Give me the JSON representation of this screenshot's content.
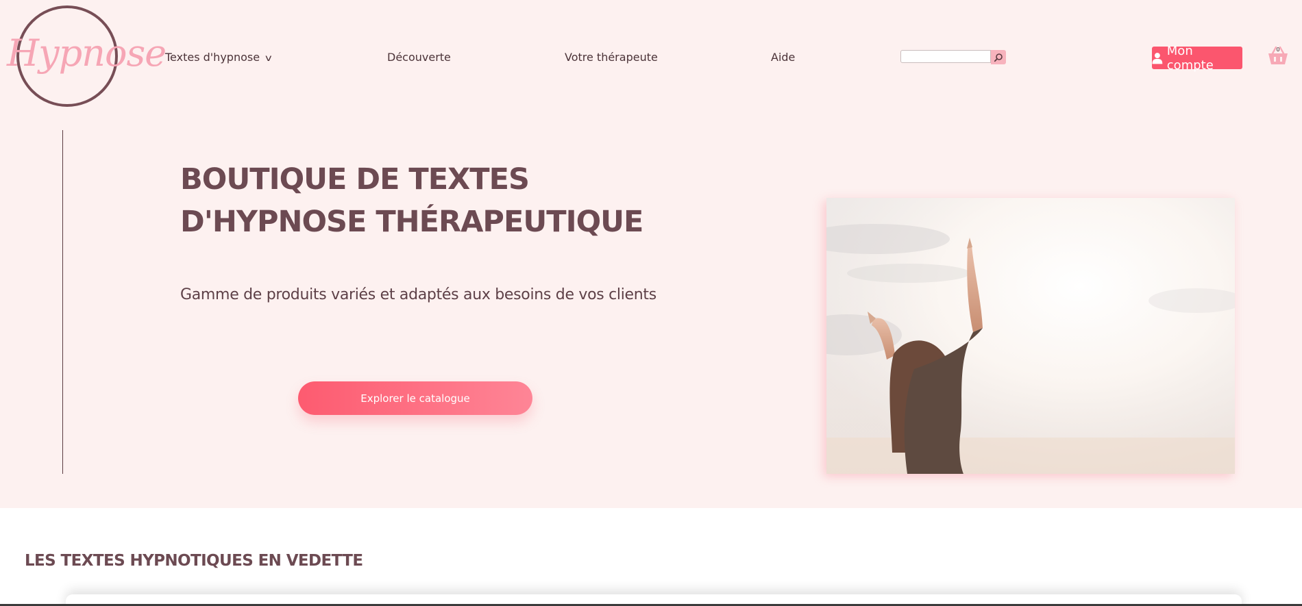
{
  "header": {
    "logo_text": "Hypnose",
    "nav": [
      {
        "label": "Textes d'hypnose",
        "has_dropdown": true
      },
      {
        "label": "Découverte"
      },
      {
        "label": "Votre thérapeute"
      },
      {
        "label": "Aide"
      }
    ],
    "search": {
      "value": "",
      "placeholder": ""
    },
    "account_label": "Mon compte",
    "cart_count": "0"
  },
  "hero": {
    "title": "BOUTIQUE DE TEXTES D'HYPNOSE THÉRAPEUTIQUE",
    "subtitle": "Gamme de produits variés et adaptés aux besoins de vos clients",
    "cta_label": "Explorer le catalogue",
    "image_icon": "woman-raising-arms-sky-photo"
  },
  "featured": {
    "title": "LES TEXTES HYPNOTIQUES EN VEDETTE"
  },
  "colors": {
    "hero_background": "#fdf1f0",
    "accent": "#fb566e",
    "title": "#6c4a52",
    "logo_pink": "#f6a6b5",
    "logo_circle": "#774e56"
  },
  "icons": {
    "search": "search-icon",
    "chevron": "chevron-down-icon",
    "user": "user-icon",
    "cart": "basket-icon"
  }
}
